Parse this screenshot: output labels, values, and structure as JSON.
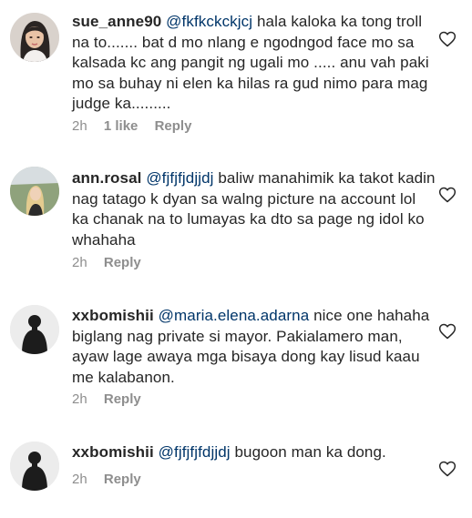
{
  "comments": [
    {
      "username": "sue_anne90",
      "mention": "@fkfkckckjcj",
      "text": "  hala kaloka ka tong troll na to....... bat d mo nlang e ngodngod face mo sa kalsada kc ang pangit ng ugali mo ..... anu vah paki mo sa buhay ni elen ka hilas ra gud nimo para mag judge ka.........",
      "time": "2h",
      "likes": "1 like",
      "reply": "Reply",
      "avatar": "profile-photo-woman",
      "heart_icon": "heart-outline-icon"
    },
    {
      "username": "ann.rosal",
      "mention": "@fjfjfjdjjdj",
      "text": " baliw manahimik ka takot kadin nag tatago k dyan sa walng picture na account lol ka chanak na to lumayas ka dto sa page ng idol ko whahaha",
      "time": "2h",
      "reply": "Reply",
      "avatar": "profile-photo-woman-outdoor",
      "heart_icon": "heart-outline-icon"
    },
    {
      "username": "xxbomishii",
      "mention": "@maria.elena.adarna",
      "text": " nice one hahaha biglang nag private si mayor. Pakialamero man, ayaw lage awaya mga bisaya dong kay lisud kaau me kalabanon.",
      "time": "2h",
      "reply": "Reply",
      "avatar": "profile-photo-dark-figure",
      "heart_icon": "heart-outline-icon"
    },
    {
      "username": "xxbomishii",
      "mention": "@fjfjfjfdjjdj",
      "text": " bugoon man ka dong.",
      "time": "2h",
      "reply": "Reply",
      "avatar": "profile-photo-dark-figure",
      "heart_icon": "heart-outline-icon"
    }
  ],
  "colors": {
    "text": "#262626",
    "mention": "#003569",
    "meta": "#8e8e8e"
  }
}
